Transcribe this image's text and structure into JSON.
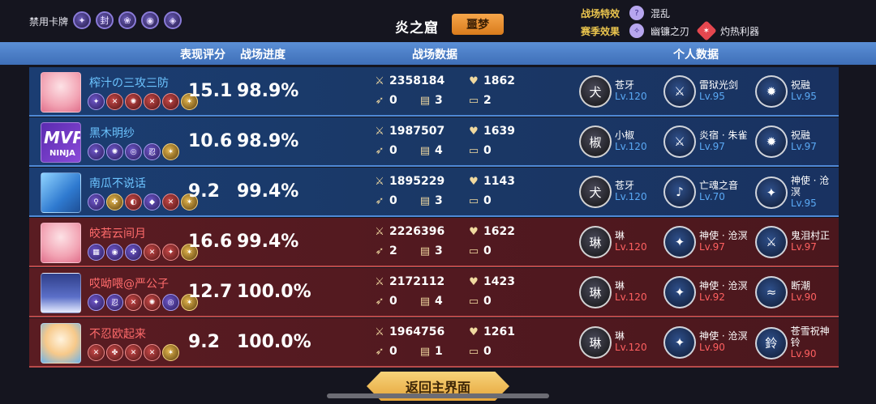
{
  "top": {
    "ban_label": "禁用卡牌",
    "ban_icons": [
      "✦",
      "封",
      "❀",
      "◉",
      "◈"
    ],
    "map_title": "炎之窟",
    "difficulty": "噩梦",
    "effects": [
      {
        "key": "战场特效",
        "items": [
          {
            "icon": "?",
            "icon_name": "chaos-icon",
            "text": "混乱",
            "style": ""
          }
        ]
      },
      {
        "key": "赛季效果",
        "items": [
          {
            "icon": "✧",
            "icon_name": "blade-icon",
            "text": "幽镰之刃",
            "style": ""
          },
          {
            "icon": "✶",
            "icon_name": "flame-icon",
            "text": "灼热利器",
            "style": "red"
          }
        ]
      }
    ]
  },
  "header": {
    "score": "表现评分",
    "progress": "战场进度",
    "battle_data": "战场数据",
    "personal_data": "个人数据"
  },
  "rows": [
    {
      "team": "blue",
      "name": "榨汁の三攻三防",
      "avatar": "pink",
      "cards": [
        "✦",
        "✕",
        "✺",
        "✕",
        "✦",
        "✶"
      ],
      "card_styles": [
        "",
        "r",
        "r",
        "r",
        "r",
        "g"
      ],
      "score": "15.1",
      "progress": "98.9%",
      "damage": "2358184",
      "heal": "1862",
      "s1": "0",
      "s2": "3",
      "s3": "2",
      "heroes": [
        {
          "name": "苍牙",
          "lv": "Lv.120",
          "icon": "犬"
        },
        {
          "name": "雷狱光剑",
          "lv": "Lv.95",
          "icon": "⚔"
        },
        {
          "name": "祝融",
          "lv": "Lv.95",
          "icon": "✹"
        }
      ]
    },
    {
      "team": "blue",
      "name": "黑木明纱",
      "avatar": "mvp",
      "mvp": "MVP",
      "ninja": "NINJA",
      "cards": [
        "✦",
        "✺",
        "◎",
        "忍",
        "✶"
      ],
      "card_styles": [
        "",
        "",
        "",
        "",
        "g"
      ],
      "score": "10.6",
      "progress": "98.9%",
      "damage": "1987507",
      "heal": "1639",
      "s1": "0",
      "s2": "4",
      "s3": "0",
      "heroes": [
        {
          "name": "小椒",
          "lv": "Lv.120",
          "icon": "椒"
        },
        {
          "name": "炎宿 · 朱雀",
          "lv": "Lv.97",
          "icon": "⚔"
        },
        {
          "name": "祝融",
          "lv": "Lv.97",
          "icon": "✹"
        }
      ]
    },
    {
      "team": "blue",
      "name": "南瓜不说话",
      "avatar": "ice",
      "cards": [
        "♀",
        "✤",
        "◐",
        "◆",
        "✕",
        "✶"
      ],
      "card_styles": [
        "",
        "g",
        "r",
        "",
        "r",
        "g"
      ],
      "score": "9.2",
      "progress": "99.4%",
      "damage": "1895229",
      "heal": "1143",
      "s1": "0",
      "s2": "3",
      "s3": "0",
      "heroes": [
        {
          "name": "苍牙",
          "lv": "Lv.120",
          "icon": "犬"
        },
        {
          "name": "亡魂之音",
          "lv": "Lv.70",
          "icon": "♪"
        },
        {
          "name": "神使 · 沧溟",
          "lv": "Lv.95",
          "icon": "✦"
        }
      ]
    },
    {
      "team": "red",
      "name": "皎若云间月",
      "avatar": "pink",
      "cards": [
        "▦",
        "◉",
        "✤",
        "✕",
        "✦",
        "✶"
      ],
      "card_styles": [
        "",
        "",
        "",
        "r",
        "r",
        "g"
      ],
      "score": "16.6",
      "progress": "99.4%",
      "damage": "2226396",
      "heal": "1622",
      "s1": "2",
      "s2": "3",
      "s3": "0",
      "heroes": [
        {
          "name": "琳",
          "lv": "Lv.120",
          "icon": "琳"
        },
        {
          "name": "神使 · 沧溟",
          "lv": "Lv.97",
          "icon": "✦"
        },
        {
          "name": "鬼泪村正",
          "lv": "Lv.97",
          "icon": "⚔"
        }
      ]
    },
    {
      "team": "red",
      "name": "哎呦喂@严公子",
      "avatar": "snow",
      "cards": [
        "✦",
        "忍",
        "✕",
        "✺",
        "◎",
        "✶"
      ],
      "card_styles": [
        "",
        "",
        "r",
        "r",
        "",
        "g"
      ],
      "score": "12.7",
      "progress": "100.0%",
      "damage": "2172112",
      "heal": "1423",
      "s1": "0",
      "s2": "4",
      "s3": "0",
      "heroes": [
        {
          "name": "琳",
          "lv": "Lv.120",
          "icon": "琳"
        },
        {
          "name": "神使 · 沧溟",
          "lv": "Lv.92",
          "icon": "✦"
        },
        {
          "name": "断潮",
          "lv": "Lv.90",
          "icon": "≈"
        }
      ]
    },
    {
      "team": "red",
      "name": "不忍欧起来",
      "avatar": "girl",
      "cards": [
        "✕",
        "✤",
        "✕",
        "✕",
        "✶"
      ],
      "card_styles": [
        "r",
        "r",
        "r",
        "r",
        "g"
      ],
      "score": "9.2",
      "progress": "100.0%",
      "damage": "1964756",
      "heal": "1261",
      "s1": "0",
      "s2": "1",
      "s3": "0",
      "heroes": [
        {
          "name": "琳",
          "lv": "Lv.120",
          "icon": "琳"
        },
        {
          "name": "神使 · 沧溟",
          "lv": "Lv.90",
          "icon": "✦"
        },
        {
          "name": "苍雪祝神铃",
          "lv": "Lv.90",
          "icon": "鈴"
        }
      ]
    }
  ],
  "icons": {
    "damage": "sword-icon",
    "heal": "heart-flame-icon",
    "s1": "boot-icon",
    "s2": "scroll-icon",
    "s3": "chest-icon"
  },
  "return_button": "返回主界面",
  "colors": {
    "blue_team": "#1b3d72",
    "red_team": "#5a1c22",
    "header": "#4f82cc",
    "accent_gold": "#f0b44a"
  }
}
